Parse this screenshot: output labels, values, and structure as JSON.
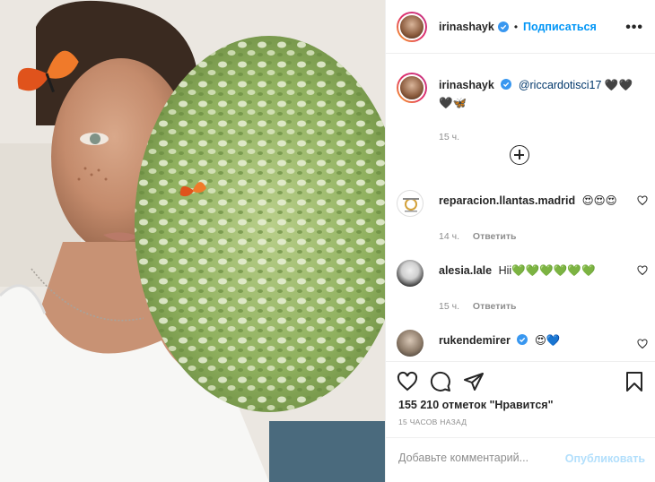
{
  "post": {
    "author": "irinashayk",
    "follow_label": "Подписаться",
    "more_label": "•••",
    "dot": "•"
  },
  "caption": {
    "username": "irinashayk",
    "mention": "@riccardotisci17",
    "emojis_line1": "🖤🖤",
    "emojis_line2": "🖤🦋",
    "time": "15 ч."
  },
  "comments": [
    {
      "username": "reparacion.llantas.madrid",
      "text": "😍😍😍",
      "time": "14 ч.",
      "reply": "Ответить"
    },
    {
      "username": "alesia.lale",
      "text": "Hii💚💚💚💚💚💚",
      "time": "15 ч.",
      "reply": "Ответить"
    },
    {
      "username": "rukendemirer",
      "text": "😍💙",
      "verified": true
    }
  ],
  "actions": {
    "icons": [
      "heart-icon",
      "comment-icon",
      "share-icon",
      "bookmark-icon"
    ],
    "likes": "155 210 отметок \"Нравится\"",
    "ago": "15 ЧАСОВ НАЗАД"
  },
  "comment_box": {
    "placeholder": "Добавьте комментарий...",
    "publish_label": "Опубликовать"
  },
  "colors": {
    "link": "#0095f6",
    "publish_disabled": "#b2dffc",
    "muted": "#8e8e8e",
    "text": "#262626"
  }
}
